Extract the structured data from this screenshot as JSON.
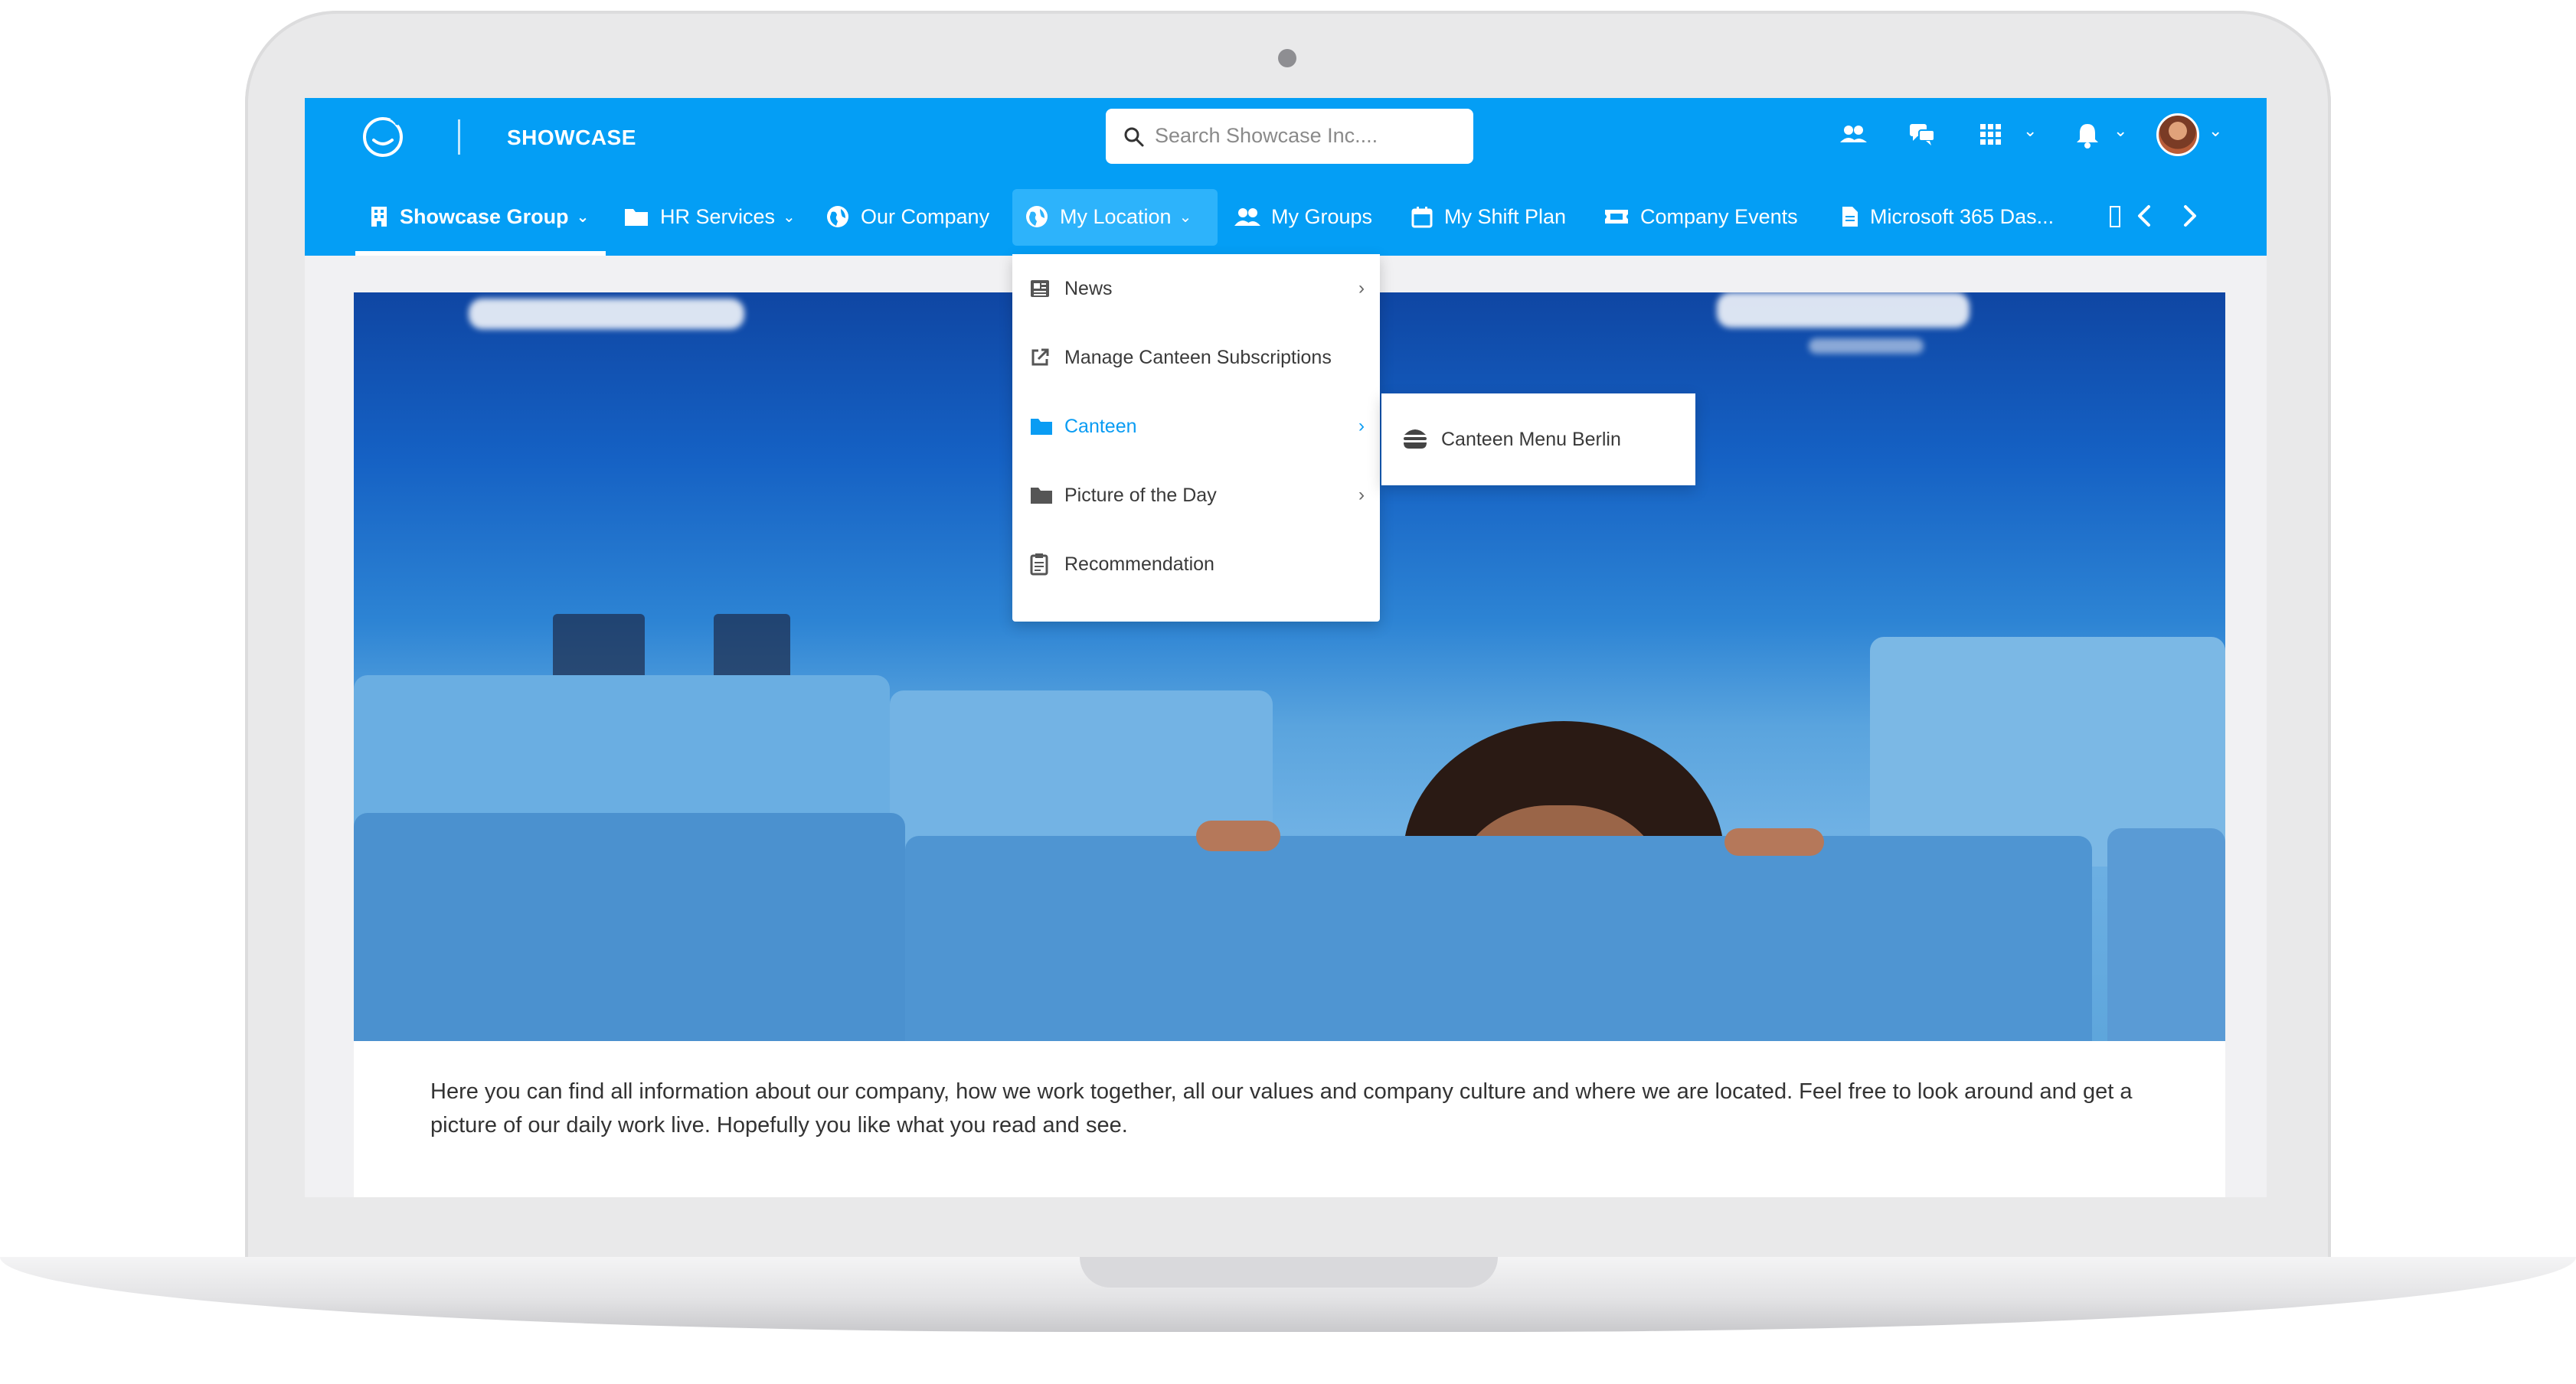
{
  "app": {
    "name": "SHOWCASE"
  },
  "search": {
    "placeholder": "Search Showcase Inc...."
  },
  "toolbar_icons": [
    "people-icon",
    "chat-icon",
    "apps-grid-icon",
    "bell-icon",
    "avatar"
  ],
  "nav": {
    "items": [
      {
        "label": "Showcase Group",
        "icon": "building-icon",
        "has_dropdown": true,
        "active": true
      },
      {
        "label": "HR Services",
        "icon": "folder-icon",
        "has_dropdown": true
      },
      {
        "label": "Our Company",
        "icon": "globe-icon"
      },
      {
        "label": "My Location",
        "icon": "globe-icon",
        "has_dropdown": true,
        "open": true
      },
      {
        "label": "My Groups",
        "icon": "groups-icon"
      },
      {
        "label": "My Shift Plan",
        "icon": "calendar-icon"
      },
      {
        "label": "Company Events",
        "icon": "ticket-icon"
      },
      {
        "label": "Microsoft 365 Das...",
        "icon": "document-icon"
      }
    ]
  },
  "dropdown": {
    "items": [
      {
        "label": "News",
        "icon": "newspaper-icon",
        "has_submenu": true
      },
      {
        "label": "Manage Canteen Subscriptions",
        "icon": "external-link-icon"
      },
      {
        "label": "Canteen",
        "icon": "folder-icon",
        "has_submenu": true,
        "active": true
      },
      {
        "label": "Picture of the Day",
        "icon": "folder-icon",
        "has_submenu": true
      },
      {
        "label": "Recommendation",
        "icon": "clipboard-icon"
      }
    ]
  },
  "submenu": {
    "items": [
      {
        "label": "Canteen Menu Berlin",
        "icon": "burger-icon"
      }
    ]
  },
  "content": {
    "intro": "Here you can find all information about our company, how we work together, all our values and company culture and where we are located. Feel free to look around and get a picture of our daily work live. Hopefully you like what you read and see."
  },
  "colors": {
    "brand": "#049ef5",
    "active_link": "#0a9cf3"
  }
}
